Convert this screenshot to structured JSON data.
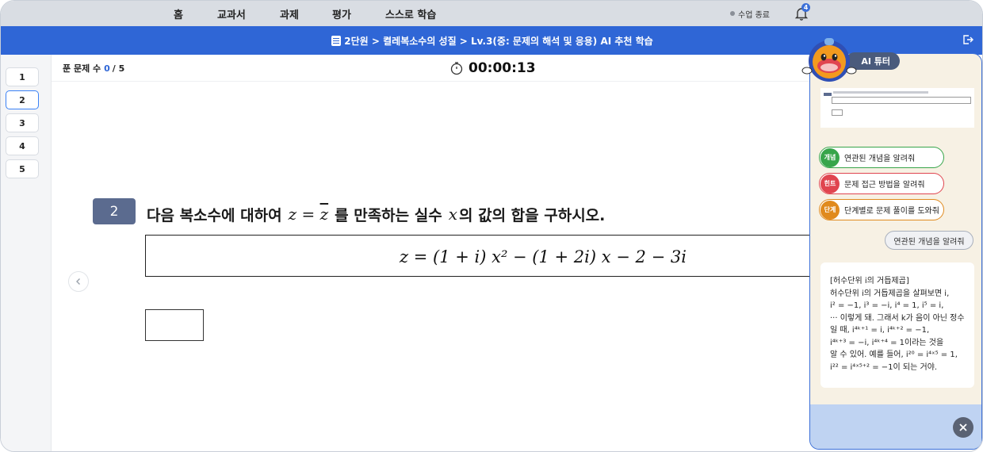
{
  "nav": {
    "items": [
      "홈",
      "교과서",
      "과제",
      "평가",
      "스스로 학습"
    ],
    "end_class": "수업 종료",
    "notification_count": "4"
  },
  "header": {
    "breadcrumb": "2단원 > 켤레복소수의 성질 > Lv.3(중: 문제의 해석 및 응용) AI 추천 학습"
  },
  "sidebar": {
    "questions": [
      "1",
      "2",
      "3",
      "4",
      "5"
    ],
    "active": "2"
  },
  "status": {
    "solved_label": "푼 문제 수",
    "solved_current": "0",
    "solved_total": "/ 5",
    "timer": "00:00:13"
  },
  "question": {
    "number": "2",
    "prompt_part1": "다음 복소수에 대하여",
    "prompt_math1": "z = z̄",
    "prompt_part2": "를 만족하는 실수",
    "prompt_math2": "x",
    "prompt_part3": "의 값의 합을 구하시오.",
    "equation": "z = (1 + i) x² − (1 + 2i) x − 2 − 3i"
  },
  "tutor": {
    "title": "AI 튜터",
    "chips": [
      {
        "tag": "개념",
        "label": "연관된 개념을 알려줘"
      },
      {
        "tag": "힌트",
        "label": "문제 접근 방법을 알려줘"
      },
      {
        "tag": "단계",
        "label": "단계별로 문제 풀이를 도와줘"
      }
    ],
    "user_message": "연관된 개념을 알려줘",
    "answer_lines": [
      "[허수단위 i의 거듭제곱]",
      "허수단위 i의 거듭제곱을 살펴보면 i,",
      "i² = −1, i³ = −i, i⁴ = 1, i⁵ = i,",
      "··· 이렇게 돼. 그래서 k가 음이 아닌 정수",
      "일 때, i⁴ᵏ⁺¹ = i, i⁴ᵏ⁺² = −1,",
      "i⁴ᵏ⁺³ = −i, i⁴ᵏ⁺⁴ = 1이라는 것을",
      "알 수 있어. 예를 들어, i²⁰ = i⁴ˣ⁵ = 1,",
      "i²² = i⁴ˣ⁵⁺² = −1이 되는 거야."
    ]
  },
  "colors": {
    "header_blue": "#2f66d6",
    "question_badge": "#5b6b8f",
    "panel_bg": "#f7f1e4",
    "chip_green": "#37a54a",
    "chip_red": "#e0454f",
    "chip_orange": "#e08a1e"
  }
}
